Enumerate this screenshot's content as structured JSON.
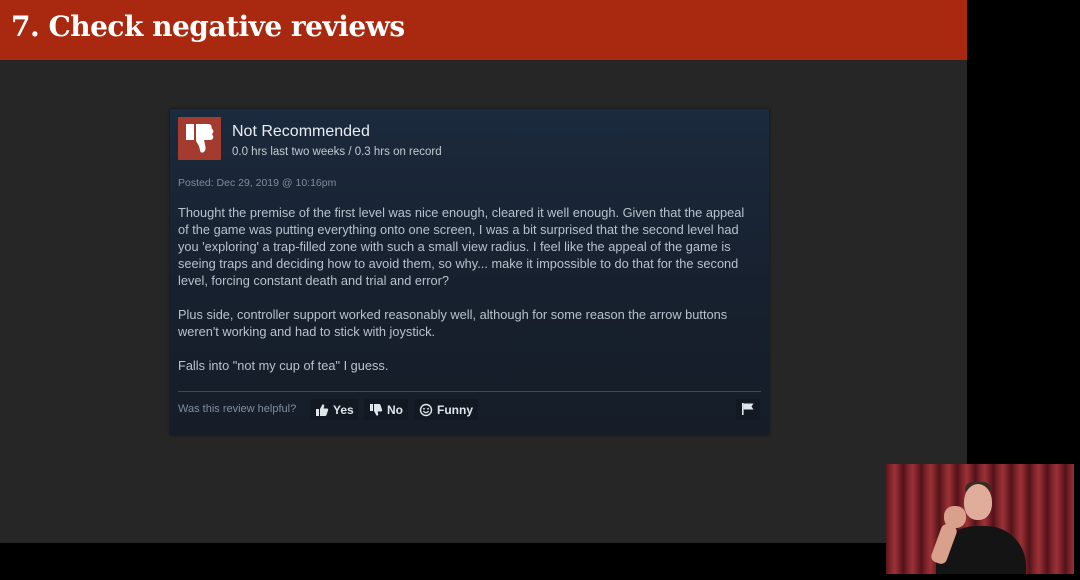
{
  "slide": {
    "title": "7. Check negative reviews"
  },
  "review": {
    "recommendation": "Not Recommended",
    "hours": "0.0 hrs last two weeks / 0.3 hrs on record",
    "posted": "Posted: Dec 29, 2019 @ 10:16pm",
    "paragraphs": [
      "Thought the premise of the first level was nice enough, cleared it well enough. Given that the appeal of the game was putting everything onto one screen, I was a bit surprised that the second level had you 'exploring' a trap-filled zone with such a small view radius. I feel like the appeal of the game is seeing traps and deciding how to avoid them, so why... make it impossible to do that for the second level, forcing constant death and trial and error?",
      "Plus side, controller support worked reasonably well, although for some reason the arrow buttons weren't working and had to stick with joystick.",
      "Falls into \"not my cup of tea\" I guess."
    ],
    "helpful_prompt": "Was this review helpful?",
    "buttons": {
      "yes": "Yes",
      "no": "No",
      "funny": "Funny"
    },
    "icons": {
      "recommendation": "thumbs-down-icon",
      "yes": "thumbs-up-icon",
      "no": "thumbs-down-icon",
      "funny": "smiley-icon",
      "report": "flag-icon"
    }
  },
  "colors": {
    "header_bar": "#a8290f",
    "slide_bg": "#262626",
    "card_bg": "#1b2a3d",
    "not_recommended_badge": "#a33b2e"
  }
}
